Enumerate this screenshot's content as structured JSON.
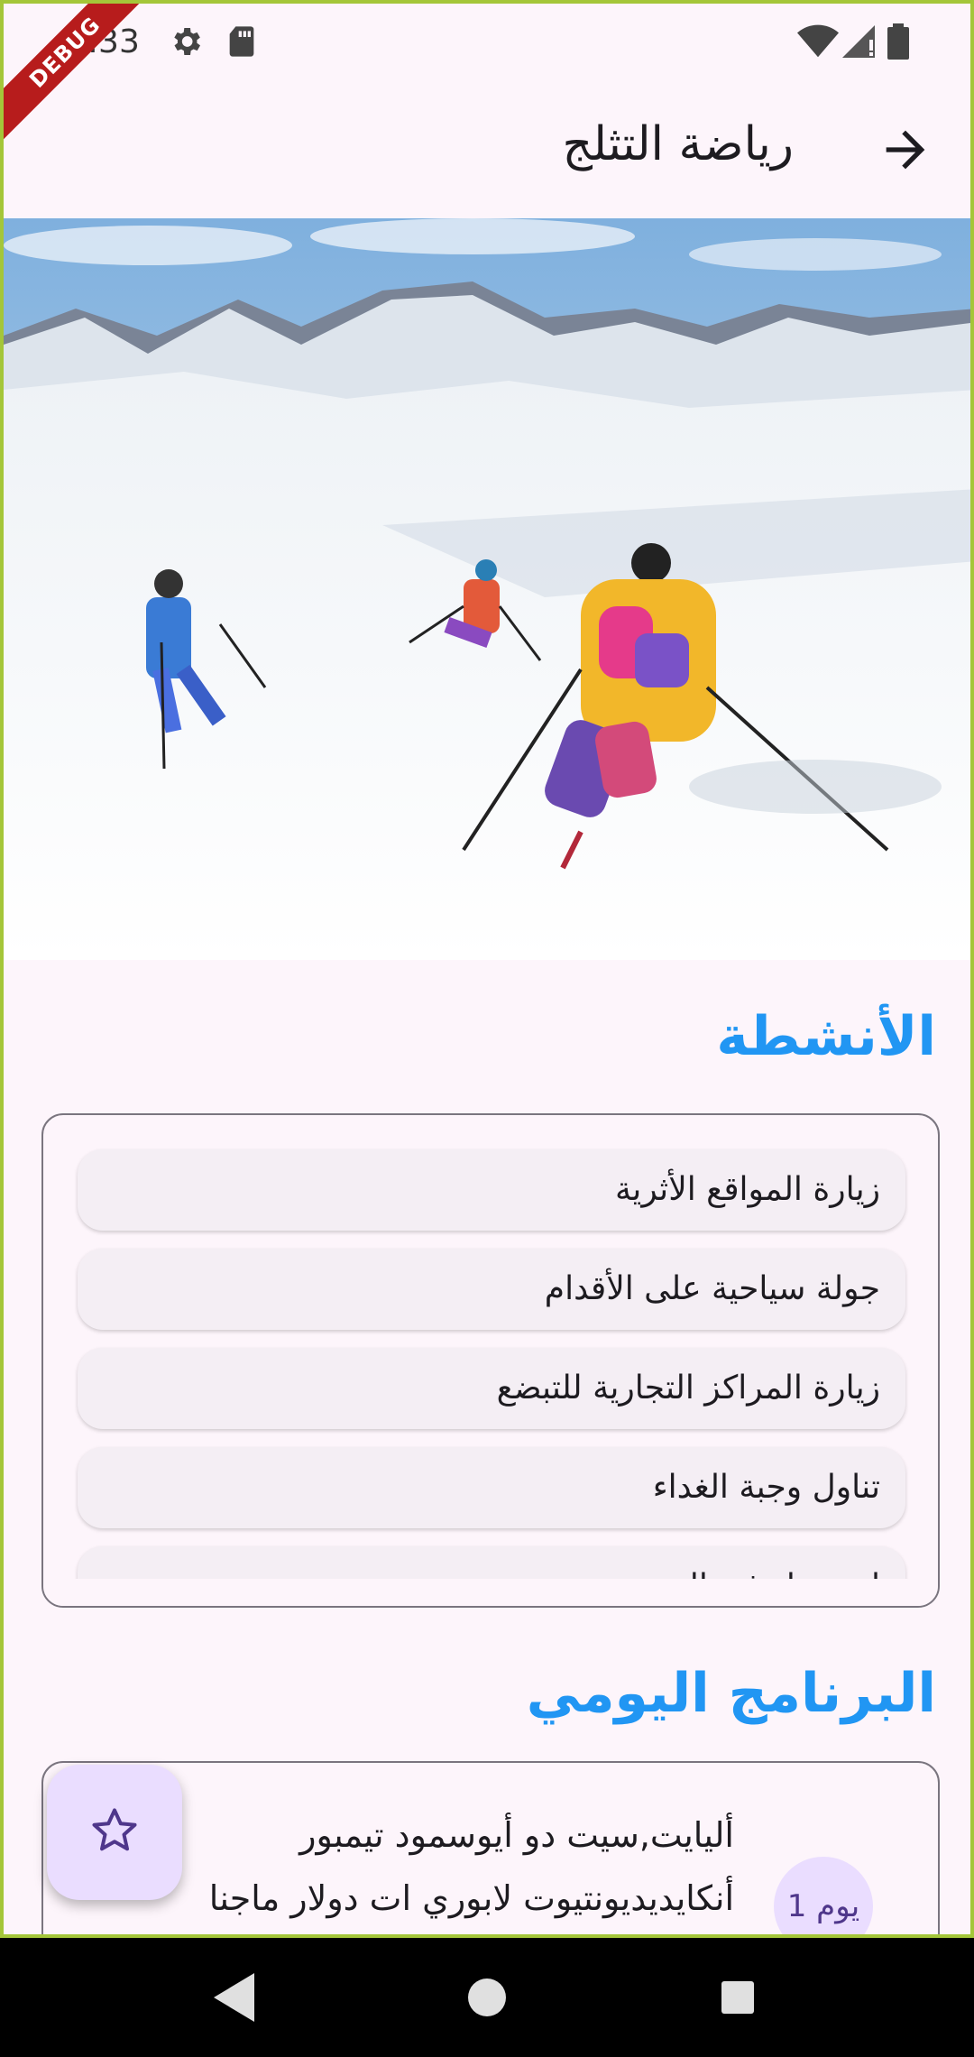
{
  "status_bar": {
    "time": "3:33",
    "debug_label": "DEBUG"
  },
  "app_bar": {
    "title": "رياضة التثلج",
    "back_icon": "arrow-forward-icon"
  },
  "hero": {
    "alt": "skiers-on-snowy-slope"
  },
  "activities": {
    "title": "الأنشطة",
    "items": [
      "زيارة المواقع الأثرية",
      "جولة سياحية على الأقدام",
      "زيارة المراكز التجارية للتبضع",
      "تناول وجبة الغداء",
      "استرخاء في المنتجع"
    ]
  },
  "program": {
    "title": "البرنامج اليومي",
    "day_label": "يوم 1",
    "lines": [
      "أليايت,سيت دو أيوسمود تيمبور",
      "أنكايديديونتيوت لابوري ات دولار ماجنا"
    ]
  },
  "fab": {
    "icon": "star-outline-icon"
  },
  "colors": {
    "accent": "#2196f3",
    "surface": "#fdf5fb",
    "chip": "#f4eef4",
    "fab": "#eaddff",
    "frame": "#a4c639"
  }
}
